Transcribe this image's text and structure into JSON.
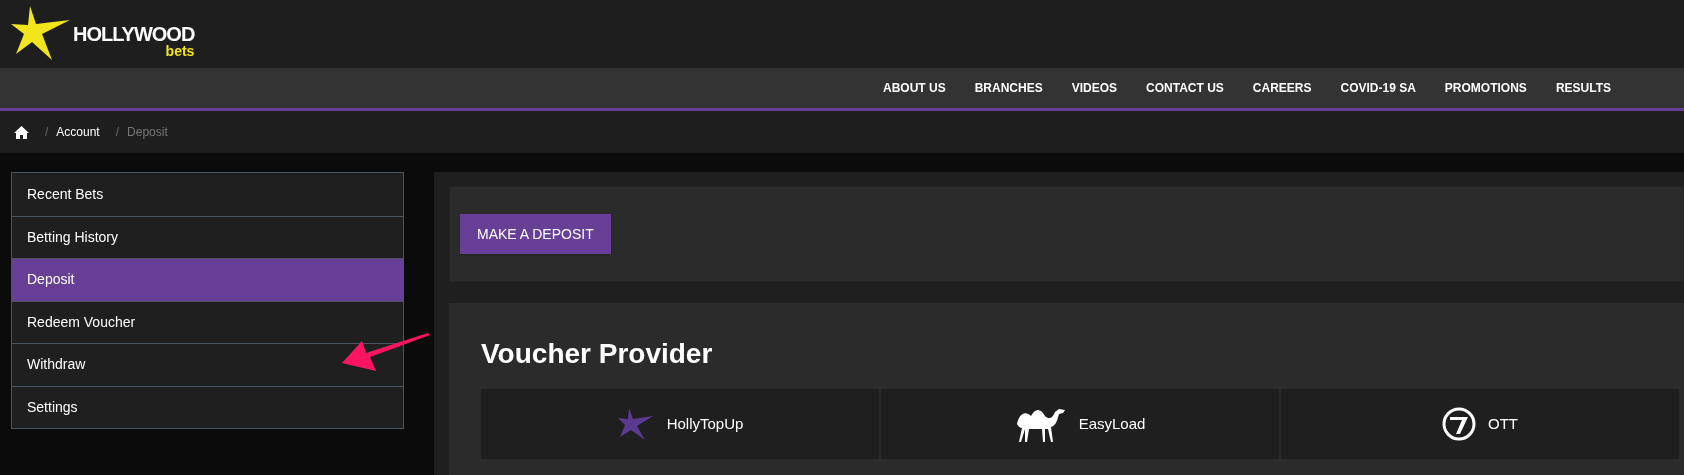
{
  "logo": {
    "word": "HOLLYWOOD",
    "sub": "bets"
  },
  "nav": [
    "ABOUT US",
    "BRANCHES",
    "VIDEOS",
    "CONTACT US",
    "CAREERS",
    "COVID-19 SA",
    "PROMOTIONS",
    "RESULTS"
  ],
  "breadcrumb": [
    {
      "separator": "/",
      "label": "Account",
      "selected": false
    },
    {
      "separator": "/",
      "label": "Deposit",
      "selected": true
    }
  ],
  "sidebar": {
    "items": [
      {
        "label": "Recent Bets",
        "selected": false
      },
      {
        "label": "Betting History",
        "selected": false
      },
      {
        "label": "Deposit",
        "selected": true
      },
      {
        "label": "Redeem Voucher",
        "selected": false
      },
      {
        "label": "Withdraw",
        "selected": false
      },
      {
        "label": "Settings",
        "selected": false
      }
    ]
  },
  "deposit_button": "MAKE A DEPOSIT",
  "voucher": {
    "title": "Voucher Provider",
    "providers": [
      {
        "kind": "star",
        "label": "HollyTopUp"
      },
      {
        "kind": "camel",
        "label": "EasyLoad"
      },
      {
        "kind": "ott",
        "label": "OTT"
      }
    ]
  }
}
